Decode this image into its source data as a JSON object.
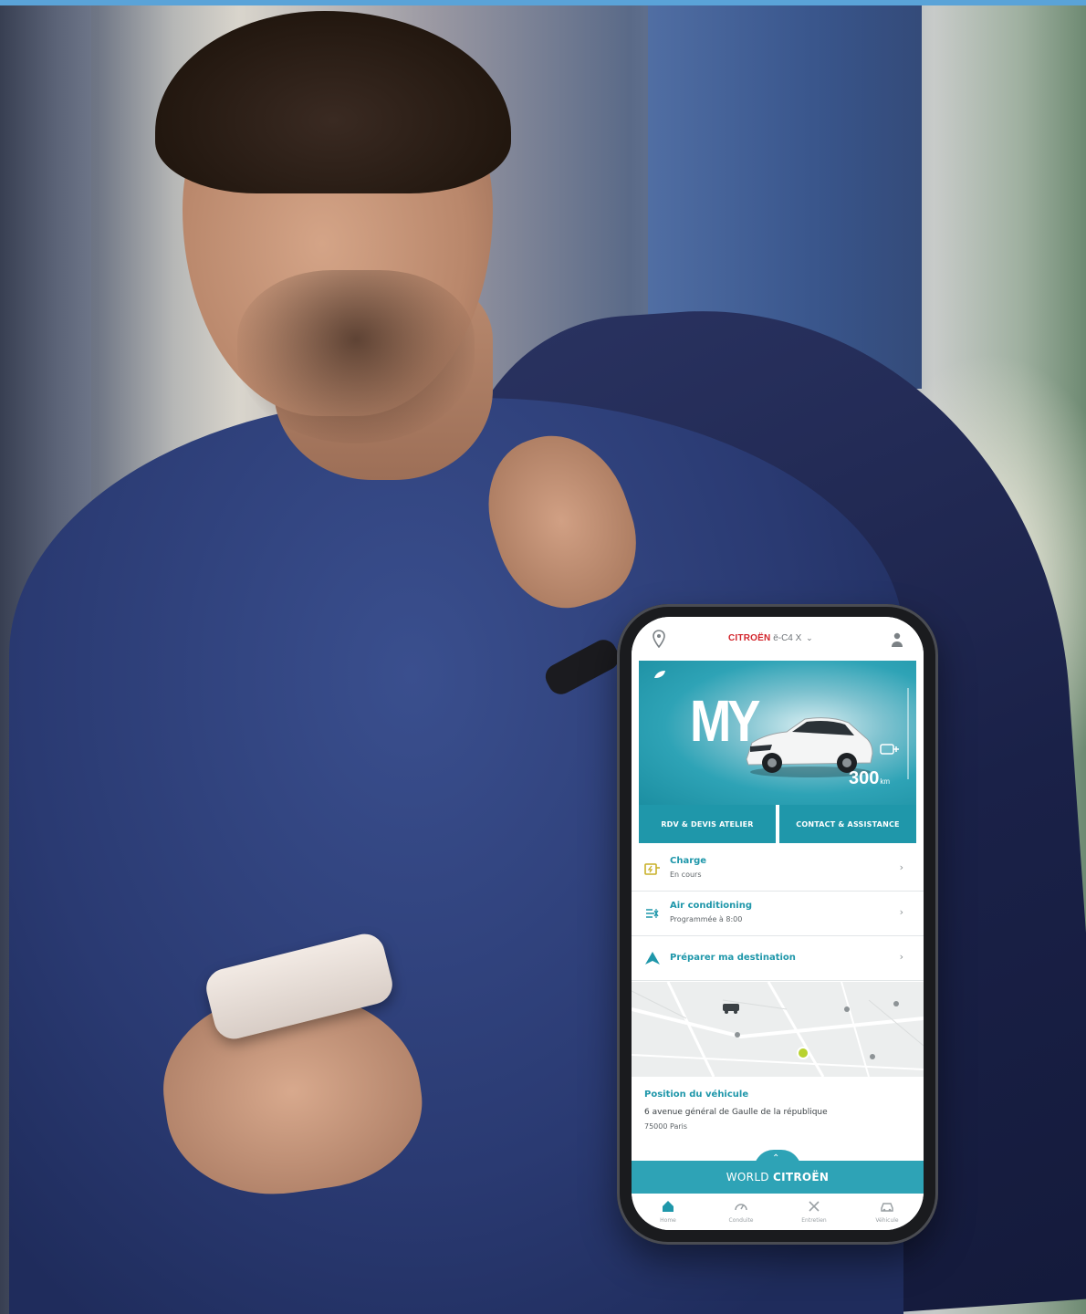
{
  "app": {
    "brand_name": "CITROËN",
    "model_name": "ë-C4 X",
    "hero_text": "MY",
    "range_value": "300",
    "range_unit": "km"
  },
  "quick_actions": [
    {
      "label": "RDV & DEVIS ATELIER"
    },
    {
      "label": "CONTACT & ASSISTANCE"
    }
  ],
  "rows": [
    {
      "title": "Charge",
      "subtitle": "En cours"
    },
    {
      "title": "Air conditioning",
      "subtitle": "Programmée à 8:00"
    },
    {
      "title": "Préparer ma destination",
      "subtitle": ""
    }
  ],
  "vehicle_position": {
    "title": "Position du véhicule",
    "address": "6 avenue général de Gaulle de la république",
    "city": "75000 Paris"
  },
  "world": {
    "prefix": "WORLD",
    "brand": "CITROËN"
  },
  "tabbar": [
    {
      "label": "Home",
      "icon": "home-icon"
    },
    {
      "label": "Conduite",
      "icon": "gauge-icon"
    },
    {
      "label": "Entretien",
      "icon": "tools-icon"
    },
    {
      "label": "Véhicule",
      "icon": "car-icon"
    }
  ],
  "colors": {
    "accent": "#1f97aa",
    "brand_red": "#d2232a",
    "hero": "#2ea3b6"
  }
}
